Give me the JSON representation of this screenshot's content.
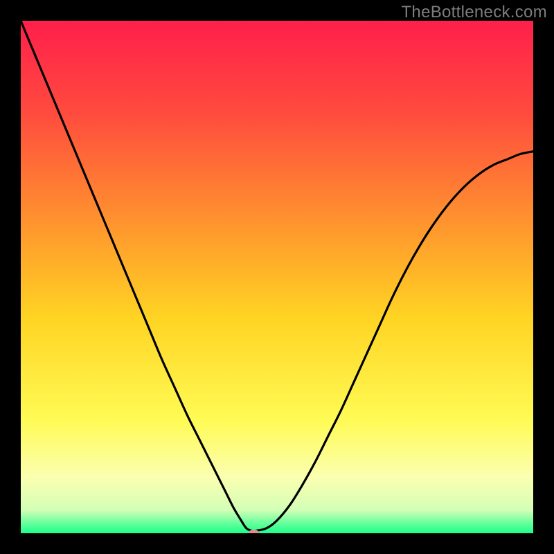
{
  "watermark": "TheBottleneck.com",
  "chart_data": {
    "type": "line",
    "title": "",
    "xlabel": "",
    "ylabel": "",
    "xlim": [
      0,
      100
    ],
    "ylim": [
      0,
      100
    ],
    "grid": false,
    "legend": false,
    "background_gradient": {
      "type": "vertical",
      "stops": [
        {
          "pos": 0.0,
          "color": "#ff1f4b"
        },
        {
          "pos": 0.18,
          "color": "#ff4b3e"
        },
        {
          "pos": 0.38,
          "color": "#ff8f2f"
        },
        {
          "pos": 0.58,
          "color": "#ffd423"
        },
        {
          "pos": 0.78,
          "color": "#fffb55"
        },
        {
          "pos": 0.89,
          "color": "#fbffb0"
        },
        {
          "pos": 0.955,
          "color": "#d3ffb6"
        },
        {
          "pos": 0.975,
          "color": "#7cffa2"
        },
        {
          "pos": 1.0,
          "color": "#1bff89"
        }
      ]
    },
    "series": [
      {
        "name": "bottleneck-curve",
        "color": "#000000",
        "x": [
          0.0,
          2.5,
          5.0,
          7.5,
          10.0,
          12.5,
          15.0,
          17.5,
          20.0,
          22.5,
          25.0,
          27.5,
          30.0,
          32.5,
          35.0,
          37.5,
          40.0,
          41.5,
          43.0,
          44.0,
          45.0,
          46.0,
          48.0,
          50.0,
          52.5,
          55.0,
          57.5,
          60.0,
          62.5,
          65.0,
          67.5,
          70.0,
          72.5,
          75.0,
          77.5,
          80.0,
          82.5,
          85.0,
          87.5,
          90.0,
          92.5,
          95.0,
          97.5,
          100.0
        ],
        "values": [
          100.0,
          94.0,
          88.0,
          82.0,
          76.0,
          70.0,
          64.0,
          58.0,
          52.0,
          46.0,
          40.0,
          34.0,
          28.5,
          23.0,
          18.0,
          13.0,
          8.0,
          5.0,
          2.5,
          1.0,
          0.5,
          0.5,
          1.0,
          2.5,
          5.5,
          9.5,
          14.0,
          19.0,
          24.0,
          29.5,
          35.0,
          40.5,
          46.0,
          51.0,
          55.5,
          59.5,
          63.0,
          66.0,
          68.5,
          70.5,
          72.0,
          73.0,
          74.0,
          74.5
        ]
      }
    ],
    "marker": {
      "name": "optimal-point",
      "x": 45.5,
      "y": 0.0,
      "color": "#e28a8f",
      "width_units": 2.0,
      "height_units": 1.4
    }
  }
}
